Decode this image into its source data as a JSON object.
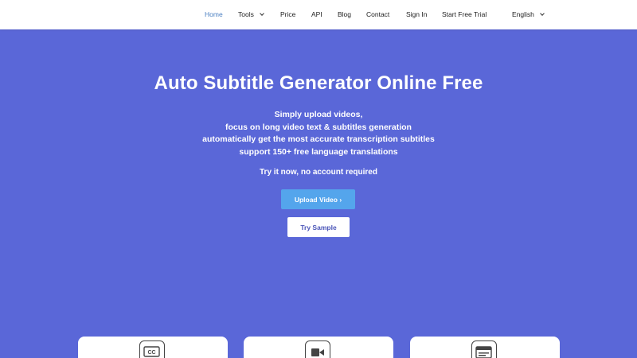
{
  "nav": {
    "home": "Home",
    "tools": "Tools",
    "price": "Price",
    "api": "API",
    "blog": "Blog",
    "contact": "Contact",
    "signin": "Sign In",
    "trial": "Start Free Trial",
    "language": "English"
  },
  "hero": {
    "title": "Auto Subtitle Generator Online Free",
    "lines": [
      "Simply upload videos,",
      "focus on long video text & subtitles generation",
      "automatically get the most accurate transcription subtitles",
      "support 150+ free language translations"
    ],
    "try_note": "Try it now, no account required",
    "upload_label": "Upload Video",
    "upload_arrow": "›",
    "sample_label": "Try Sample"
  },
  "cards": [
    {
      "icon": "closed-captions-icon",
      "icon_text": "CC"
    },
    {
      "icon": "video-camera-icon"
    },
    {
      "icon": "browser-window-icon"
    }
  ],
  "colors": {
    "hero_bg": "#5a67d8",
    "nav_active": "#4a7fc1",
    "upload_button": "#54a5ec"
  }
}
